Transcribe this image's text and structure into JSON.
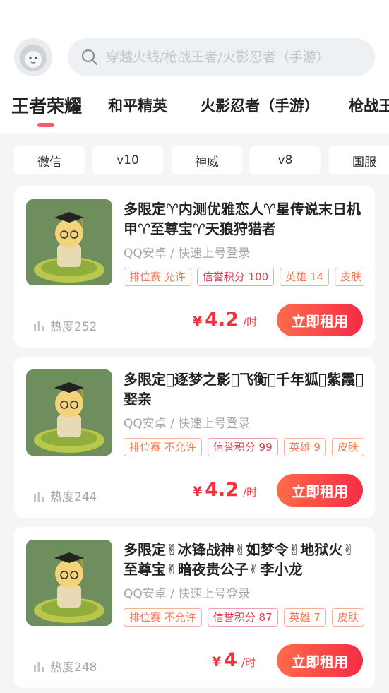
{
  "search": {
    "placeholder": "穿越火线/枪战王者/火影忍者（手游）"
  },
  "game_tabs": [
    {
      "label": "王者荣耀",
      "active": true
    },
    {
      "label": "和平精英",
      "active": false
    },
    {
      "label": "火影忍者（手游）",
      "active": false
    },
    {
      "label": "枪战王者",
      "active": false
    }
  ],
  "filters": [
    "微信",
    "v10",
    "神威",
    "v8",
    "国服"
  ],
  "listings": [
    {
      "title": "多限定♈内测优雅恋人♈星传说末日机甲♈至尊宝♈天狼狩猎者",
      "platform": "QQ安卓 / 快速上号登录",
      "tags": [
        "排位赛 允许",
        "信誉积分 100",
        "英雄 14",
        "皮肤"
      ],
      "heat": "热度252",
      "currency": "¥",
      "price": "4.2",
      "unit": "/时",
      "button": "立即租用"
    },
    {
      "title": "多限定􀀀逐梦之影􀀀飞衡􀀀千年狐􀀀紫霞􀀀娶亲",
      "platform": "QQ安卓 / 快速上号登录",
      "tags": [
        "排位赛 不允许",
        "信誉积分 99",
        "英雄 9",
        "皮肤"
      ],
      "heat": "热度244",
      "currency": "¥",
      "price": "4.2",
      "unit": "/时",
      "button": "立即租用"
    },
    {
      "title": "多限定✌冰锋战神✌如梦令✌地狱火✌至尊宝✌暗夜贵公子✌李小龙",
      "platform": "QQ安卓 / 快速上号登录",
      "tags": [
        "排位赛 不允许",
        "信誉积分 87",
        "英雄 7",
        "皮肤"
      ],
      "heat": "热度248",
      "currency": "¥",
      "price": "4",
      "unit": "/时",
      "button": "立即租用"
    }
  ],
  "colors": {
    "accent": "#f0323f",
    "tab_indicator": "#ff5a6a",
    "button_gradient_start": "#ff6b4b",
    "button_gradient_end": "#f52c45"
  }
}
